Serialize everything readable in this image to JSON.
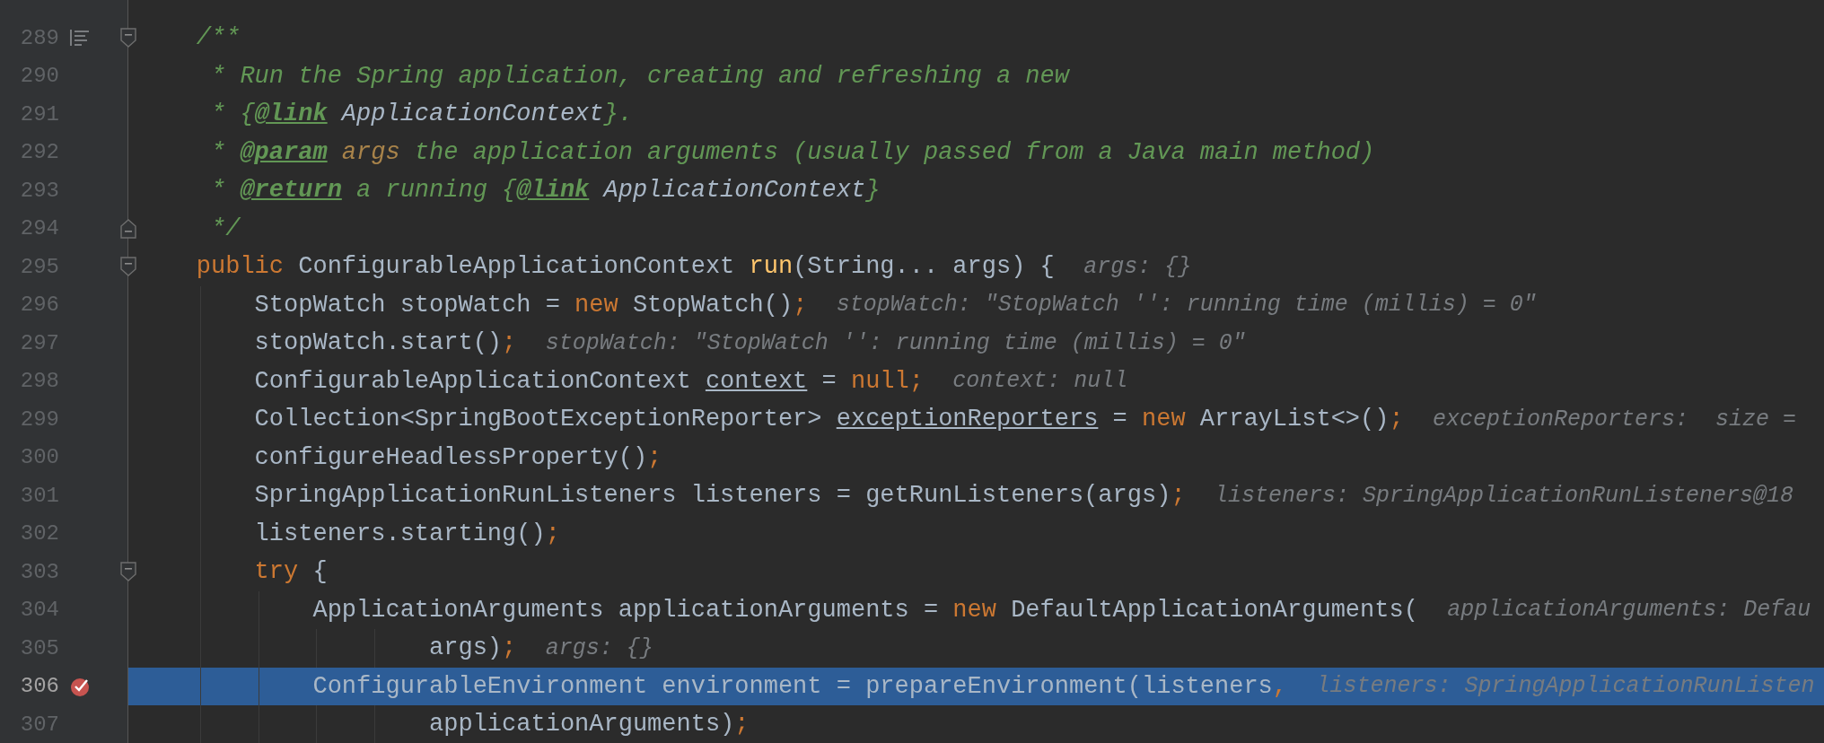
{
  "editor": {
    "lines": [
      {
        "number": "289",
        "current": false,
        "breakpoint": false,
        "doc_toggle": true,
        "fold_start": true,
        "fold_end": false,
        "tokens": [
          {
            "kind": "comment",
            "text": "    /**"
          }
        ]
      },
      {
        "number": "290",
        "current": false,
        "breakpoint": false,
        "doc_toggle": false,
        "fold_start": false,
        "fold_end": false,
        "tokens": [
          {
            "kind": "comment",
            "text": "     * Run the Spring application, creating and refreshing a new"
          }
        ]
      },
      {
        "number": "291",
        "current": false,
        "breakpoint": false,
        "doc_toggle": false,
        "fold_start": false,
        "fold_end": false,
        "tokens": [
          {
            "kind": "comment",
            "text": "     * {"
          },
          {
            "kind": "doctag",
            "text": "@link"
          },
          {
            "kind": "docref",
            "text": " ApplicationContext"
          },
          {
            "kind": "comment",
            "text": "}."
          }
        ]
      },
      {
        "number": "292",
        "current": false,
        "breakpoint": false,
        "doc_toggle": false,
        "fold_start": false,
        "fold_end": false,
        "tokens": [
          {
            "kind": "comment",
            "text": "     * "
          },
          {
            "kind": "doctag",
            "text": "@param"
          },
          {
            "kind": "docparam",
            "text": " args"
          },
          {
            "kind": "comment",
            "text": " the application arguments (usually passed from a Java main method)"
          }
        ]
      },
      {
        "number": "293",
        "current": false,
        "breakpoint": false,
        "doc_toggle": false,
        "fold_start": false,
        "fold_end": false,
        "tokens": [
          {
            "kind": "comment",
            "text": "     * "
          },
          {
            "kind": "doctag",
            "text": "@return"
          },
          {
            "kind": "comment",
            "text": " a running {"
          },
          {
            "kind": "doctag",
            "text": "@link"
          },
          {
            "kind": "docref",
            "text": " ApplicationContext"
          },
          {
            "kind": "comment",
            "text": "}"
          }
        ]
      },
      {
        "number": "294",
        "current": false,
        "breakpoint": false,
        "doc_toggle": false,
        "fold_start": false,
        "fold_end": true,
        "tokens": [
          {
            "kind": "comment",
            "text": "     */"
          }
        ]
      },
      {
        "number": "295",
        "current": false,
        "breakpoint": false,
        "doc_toggle": false,
        "fold_start": true,
        "fold_end": false,
        "tokens": [
          {
            "kind": "keyword",
            "text": "    public"
          },
          {
            "kind": "plain",
            "text": " ConfigurableApplicationContext "
          },
          {
            "kind": "method",
            "text": "run"
          },
          {
            "kind": "plain",
            "text": "(String... args) {"
          }
        ],
        "hint": "args: {}"
      },
      {
        "number": "296",
        "current": false,
        "breakpoint": false,
        "doc_toggle": false,
        "fold_start": false,
        "fold_end": false,
        "tokens": [
          {
            "kind": "plain",
            "text": "        StopWatch stopWatch = "
          },
          {
            "kind": "keyword",
            "text": "new"
          },
          {
            "kind": "plain",
            "text": " StopWatch()"
          },
          {
            "kind": "keyword",
            "text": ";"
          }
        ],
        "hint": "stopWatch: \"StopWatch '': running time (millis) = 0\""
      },
      {
        "number": "297",
        "current": false,
        "breakpoint": false,
        "doc_toggle": false,
        "fold_start": false,
        "fold_end": false,
        "tokens": [
          {
            "kind": "plain",
            "text": "        stopWatch.start()"
          },
          {
            "kind": "keyword",
            "text": ";"
          }
        ],
        "hint": "stopWatch: \"StopWatch '': running time (millis) = 0\""
      },
      {
        "number": "298",
        "current": false,
        "breakpoint": false,
        "doc_toggle": false,
        "fold_start": false,
        "fold_end": false,
        "tokens": [
          {
            "kind": "plain",
            "text": "        ConfigurableApplicationContext "
          },
          {
            "kind": "variable",
            "text": "context"
          },
          {
            "kind": "plain",
            "text": " = "
          },
          {
            "kind": "keyword",
            "text": "null;"
          }
        ],
        "hint": "context: null"
      },
      {
        "number": "299",
        "current": false,
        "breakpoint": false,
        "doc_toggle": false,
        "fold_start": false,
        "fold_end": false,
        "tokens": [
          {
            "kind": "plain",
            "text": "        Collection<SpringBootExceptionReporter> "
          },
          {
            "kind": "variable",
            "text": "exceptionReporters"
          },
          {
            "kind": "plain",
            "text": " = "
          },
          {
            "kind": "keyword",
            "text": "new"
          },
          {
            "kind": "plain",
            "text": " ArrayList<>()"
          },
          {
            "kind": "keyword",
            "text": ";"
          }
        ],
        "hint": "exceptionReporters:  size ="
      },
      {
        "number": "300",
        "current": false,
        "breakpoint": false,
        "doc_toggle": false,
        "fold_start": false,
        "fold_end": false,
        "tokens": [
          {
            "kind": "plain",
            "text": "        configureHeadlessProperty()"
          },
          {
            "kind": "keyword",
            "text": ";"
          }
        ]
      },
      {
        "number": "301",
        "current": false,
        "breakpoint": false,
        "doc_toggle": false,
        "fold_start": false,
        "fold_end": false,
        "tokens": [
          {
            "kind": "plain",
            "text": "        SpringApplicationRunListeners listeners = getRunListeners(args)"
          },
          {
            "kind": "keyword",
            "text": ";"
          }
        ],
        "hint": "listeners: SpringApplicationRunListeners@18"
      },
      {
        "number": "302",
        "current": false,
        "breakpoint": false,
        "doc_toggle": false,
        "fold_start": false,
        "fold_end": false,
        "tokens": [
          {
            "kind": "plain",
            "text": "        listeners.starting()"
          },
          {
            "kind": "keyword",
            "text": ";"
          }
        ]
      },
      {
        "number": "303",
        "current": false,
        "breakpoint": false,
        "doc_toggle": false,
        "fold_start": true,
        "fold_end": false,
        "tokens": [
          {
            "kind": "keyword",
            "text": "        try"
          },
          {
            "kind": "plain",
            "text": " {"
          }
        ]
      },
      {
        "number": "304",
        "current": false,
        "breakpoint": false,
        "doc_toggle": false,
        "fold_start": false,
        "fold_end": false,
        "tokens": [
          {
            "kind": "plain",
            "text": "            ApplicationArguments applicationArguments = "
          },
          {
            "kind": "keyword",
            "text": "new"
          },
          {
            "kind": "plain",
            "text": " DefaultApplicationArguments("
          }
        ],
        "hint": "applicationArguments: Defau"
      },
      {
        "number": "305",
        "current": false,
        "breakpoint": false,
        "doc_toggle": false,
        "fold_start": false,
        "fold_end": false,
        "tokens": [
          {
            "kind": "plain",
            "text": "                    args)"
          },
          {
            "kind": "keyword",
            "text": ";"
          }
        ],
        "hint": "args: {}"
      },
      {
        "number": "306",
        "current": true,
        "breakpoint": true,
        "doc_toggle": false,
        "fold_start": false,
        "fold_end": false,
        "tokens": [
          {
            "kind": "plain",
            "text": "            ConfigurableEnvironment environment = prepareEnvironment(listeners"
          },
          {
            "kind": "keyword",
            "text": ","
          }
        ],
        "hint": "listeners: SpringApplicationRunListen"
      },
      {
        "number": "307",
        "current": false,
        "breakpoint": false,
        "doc_toggle": false,
        "fold_start": false,
        "fold_end": false,
        "tokens": [
          {
            "kind": "plain",
            "text": "                    applicationArguments)"
          },
          {
            "kind": "keyword",
            "text": ";"
          }
        ]
      }
    ]
  }
}
